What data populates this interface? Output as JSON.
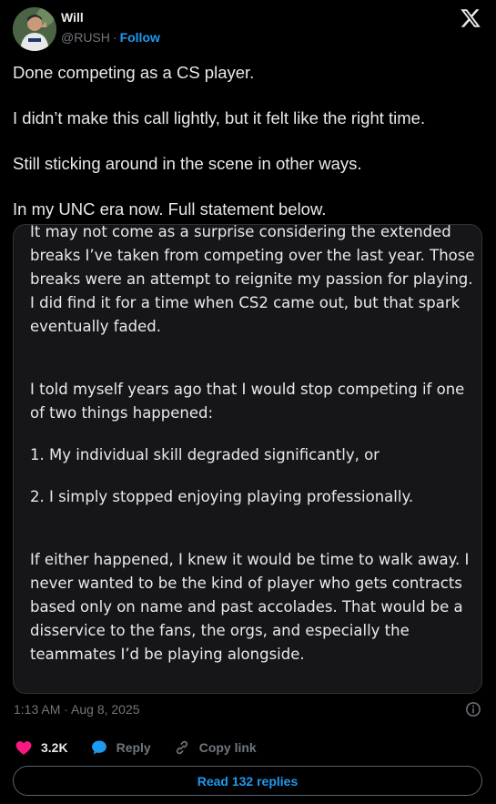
{
  "author": {
    "name": "Will",
    "handle": "@RUSH",
    "separator": "·",
    "follow_label": "Follow",
    "avatar_icon": "avatar-photo"
  },
  "tweet": {
    "lines": [
      "Done competing as a CS player.",
      "I didn’t make this call lightly, but it felt like the right time.",
      "Still sticking around in the scene in other ways.",
      "In my UNC era now.  Full statement below."
    ]
  },
  "statement": {
    "para1": "It may not come as a surprise considering the extended breaks I’ve taken from competing over the last year. Those breaks were an attempt to reignite my passion for playing. I did find it for a time when CS2 came out, but that spark eventually faded.",
    "para2": "I told myself years ago that I would stop competing if one of two things happened:",
    "item1": "1. My individual skill degraded significantly, or",
    "item2": "2. I simply stopped enjoying playing professionally.",
    "para3": "If either happened, I knew it would be time to walk away. I never wanted to be the kind of player who gets contracts based only on name and past accolades. That would be a disservice to the fans, the orgs, and especially the teammates I’d be playing alongside."
  },
  "meta": {
    "timestamp": "1:13 AM · Aug 8, 2025"
  },
  "actions": {
    "likes": "3.2K",
    "reply_label": "Reply",
    "copy_link_label": "Copy link"
  },
  "read_replies_label": "Read 132 replies",
  "colors": {
    "accent": "#1d9bf0",
    "like": "#f91880",
    "background": "#000000",
    "card": "#161618"
  }
}
